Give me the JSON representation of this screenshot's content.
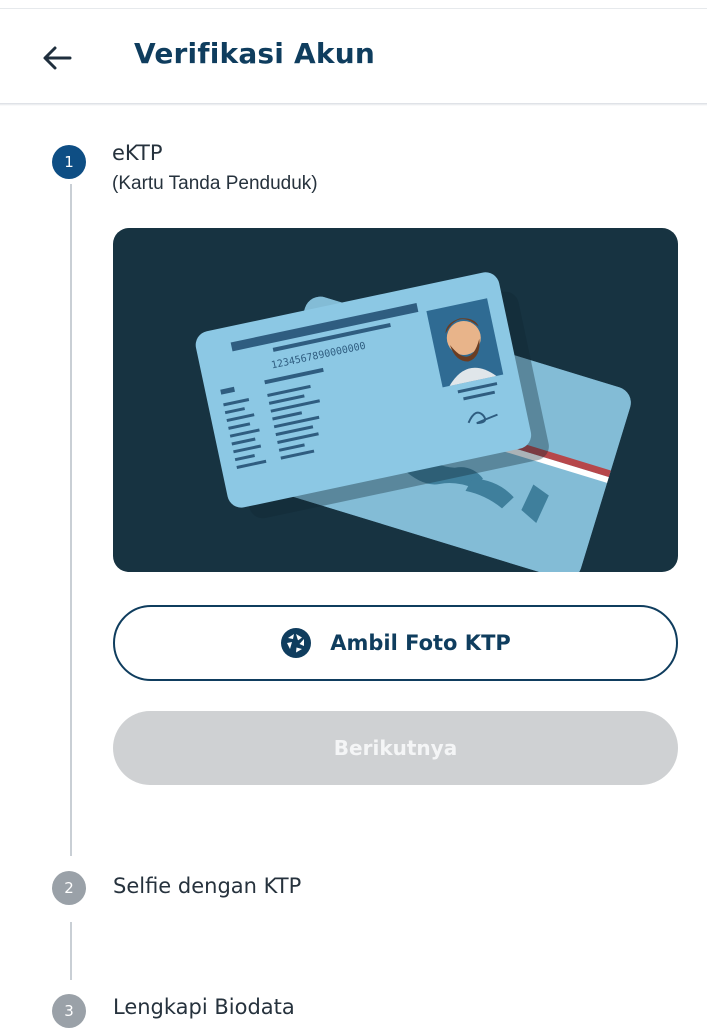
{
  "header": {
    "back_icon": "arrow-left-icon",
    "title": "Verifikasi Akun"
  },
  "steps": [
    {
      "number": "1",
      "title": "eKTP",
      "subtitle": "(Kartu Tanda Penduduk)",
      "status": "active"
    },
    {
      "number": "2",
      "title": "Selfie dengan KTP",
      "status": "inactive"
    },
    {
      "number": "3",
      "title": "Lengkapi Biodata",
      "status": "inactive"
    }
  ],
  "card_illustration": {
    "id_number": "1234567890000000"
  },
  "buttons": {
    "take_photo": {
      "label": "Ambil Foto KTP",
      "icon": "camera-shutter-icon"
    },
    "next": {
      "label": "Berikutnya",
      "enabled": false
    }
  },
  "colors": {
    "primary": "#0f3d5e",
    "active_step": "#0e4e84",
    "inactive_step": "#9aa1a8",
    "disabled_button": "#cfd1d3",
    "illustration_bg": "#173341",
    "card_blue": "#8cc8e4"
  }
}
